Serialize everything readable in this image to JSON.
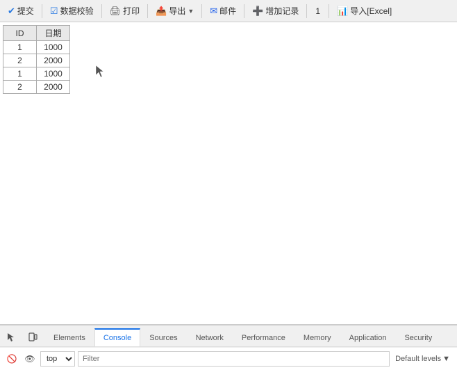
{
  "toolbar": {
    "submit_label": "提交",
    "validate_label": "数据校验",
    "print_label": "打印",
    "export_label": "导出",
    "email_label": "邮件",
    "add_label": "增加记录",
    "page_number": "1",
    "import_label": "导入[Excel]"
  },
  "table": {
    "headers": [
      "ID",
      "日期"
    ],
    "rows": [
      [
        "1",
        "1000"
      ],
      [
        "2",
        "2000"
      ],
      [
        "1",
        "1000"
      ],
      [
        "2",
        "2000"
      ]
    ]
  },
  "devtools": {
    "tabs": [
      {
        "label": "Elements",
        "active": false
      },
      {
        "label": "Console",
        "active": true
      },
      {
        "label": "Sources",
        "active": false
      },
      {
        "label": "Network",
        "active": false
      },
      {
        "label": "Performance",
        "active": false
      },
      {
        "label": "Memory",
        "active": false
      },
      {
        "label": "Application",
        "active": false
      },
      {
        "label": "Security",
        "active": false
      }
    ],
    "console_bar": {
      "context_value": "top",
      "filter_placeholder": "Filter",
      "default_levels_label": "Default levels"
    }
  }
}
